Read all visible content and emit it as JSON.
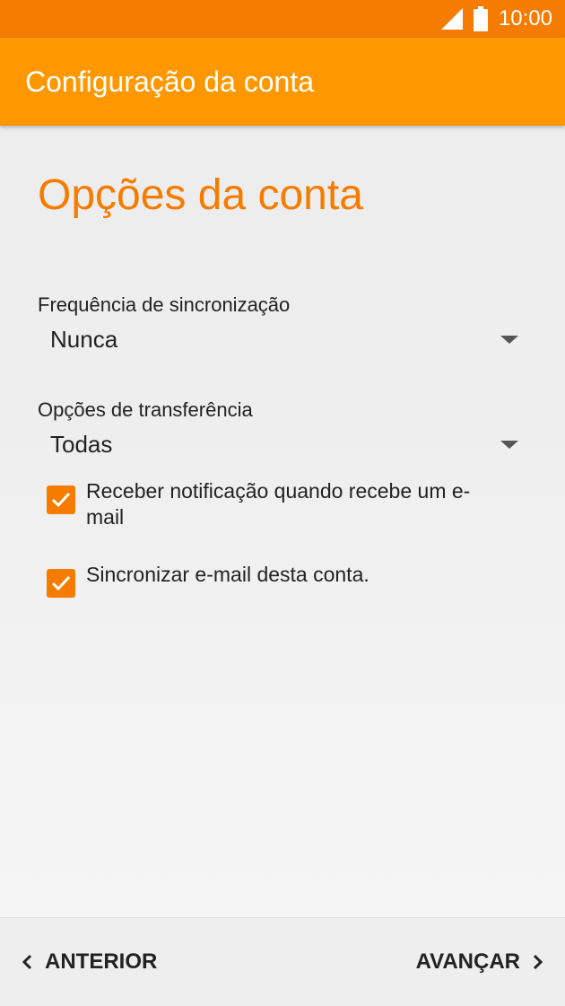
{
  "status_bar": {
    "time": "10:00",
    "icons": [
      "signal-icon",
      "battery-icon"
    ]
  },
  "app_bar": {
    "title": "Configuração da conta"
  },
  "main": {
    "heading": "Opções da conta",
    "sync_frequency": {
      "label": "Frequência de sincronização",
      "value": "Nunca"
    },
    "transfer_options": {
      "label": "Opções de transferência",
      "value": "Todas"
    },
    "checkboxes": [
      {
        "label": "Receber notificação quando recebe um e-mail",
        "checked": true
      },
      {
        "label": "Sincronizar e-mail desta conta.",
        "checked": true
      }
    ]
  },
  "bottom_nav": {
    "back_label": "ANTERIOR",
    "next_label": "AVANÇAR"
  },
  "colors": {
    "accent": "#ff9800",
    "accent_dark": "#f57c00",
    "background": "#eeeeee",
    "text": "#222222"
  }
}
